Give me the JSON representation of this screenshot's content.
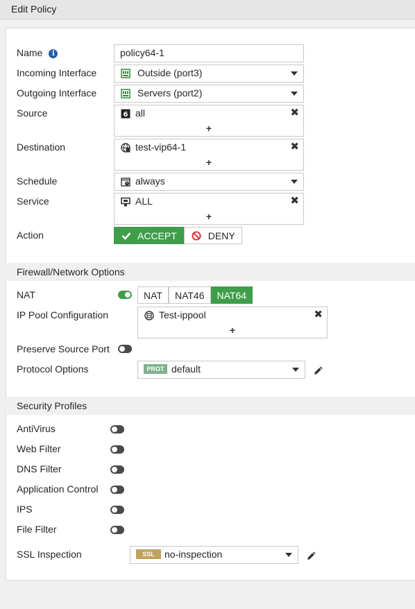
{
  "header": {
    "title": "Edit Policy"
  },
  "fields": {
    "name_label": "Name",
    "name_value": "policy64-1",
    "incoming_label": "Incoming Interface",
    "incoming_value": "Outside (port3)",
    "outgoing_label": "Outgoing Interface",
    "outgoing_value": "Servers (port2)",
    "source_label": "Source",
    "source_value": "all",
    "destination_label": "Destination",
    "destination_value": "test-vip64-1",
    "schedule_label": "Schedule",
    "schedule_value": "always",
    "service_label": "Service",
    "service_value": "ALL",
    "action_label": "Action",
    "action_accept": "ACCEPT",
    "action_deny": "DENY",
    "add_symbol": "+",
    "remove_symbol": "✖"
  },
  "firewall": {
    "section_title": "Firewall/Network Options",
    "nat_label": "NAT",
    "nat_options": [
      "NAT",
      "NAT46",
      "NAT64"
    ],
    "nat_selected": "NAT64",
    "nat_enabled": true,
    "ippool_label": "IP Pool Configuration",
    "ippool_value": "Test-ippool",
    "preserve_label": "Preserve Source Port",
    "preserve_enabled": false,
    "protocol_label": "Protocol Options",
    "protocol_badge": "PROT",
    "protocol_value": "default"
  },
  "security": {
    "section_title": "Security Profiles",
    "profiles": [
      {
        "label": "AntiVirus",
        "enabled": false
      },
      {
        "label": "Web Filter",
        "enabled": false
      },
      {
        "label": "DNS Filter",
        "enabled": false
      },
      {
        "label": "Application Control",
        "enabled": false
      },
      {
        "label": "IPS",
        "enabled": false
      },
      {
        "label": "File Filter",
        "enabled": false
      }
    ],
    "ssl_label": "SSL Inspection",
    "ssl_badge": "SSL",
    "ssl_value": "no-inspection"
  },
  "colors": {
    "accent_green": "#3e9e4a",
    "info_blue": "#1f5fa8",
    "deny_red": "#d9262c",
    "prot_badge": "#7fb28a",
    "ssl_badge": "#bfa25a",
    "interface_icon": "#2f8a3e"
  },
  "icons": {
    "name_info": "info-icon",
    "interface": "interface-port-icon",
    "source": "address-icon",
    "destination": "vip-icon",
    "schedule": "schedule-clock-icon",
    "service": "service-icon",
    "accept": "check-icon",
    "deny": "deny-icon",
    "ippool": "ippool-icon",
    "edit": "pencil-icon"
  }
}
